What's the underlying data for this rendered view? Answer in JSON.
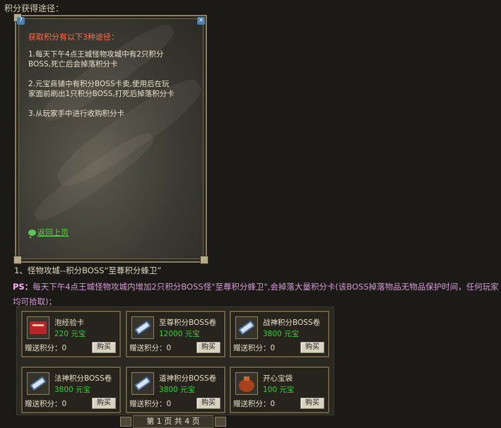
{
  "page": {
    "heading": "积分获得途径："
  },
  "dialog": {
    "help_glyph": "?",
    "close_glyph": "×",
    "title": "获取积分有以下3种途径：",
    "lines": [
      "1.每天下午4点王城怪物攻城中有2只积分",
      "BOSS,死亡后会掉落积分卡",
      "2.元宝商铺中有积分BOSS卡卖,使用后在玩",
      "家面前刷出1只积分BOSS,打死后掉落积分卡",
      "3.从玩家手中进行收购积分卡"
    ],
    "back_link": "返回上页"
  },
  "section": {
    "line1": "1、怪物攻城--积分BOSS“至尊积分蜂卫”",
    "ps_label": "PS：",
    "ps_text": "每天下午4点王城怪物攻城内增加2只积分BOSS怪\"至尊积分蜂卫\",会掉落大量积分卡(该BOSS掉落物品无物品保护时间，任何玩家均可拾取)；"
  },
  "shop": {
    "items": [
      {
        "name": "泡经验卡",
        "price": "220 元宝",
        "gift": "赠送积分：0",
        "buy": "购买",
        "icon": "card-icon",
        "color": "#b8242a"
      },
      {
        "name": "至尊积分BOSS卷",
        "price": "12000 元宝",
        "gift": "赠送积分：0",
        "buy": "购买",
        "icon": "scroll-icon",
        "color": "#4a6ea8"
      },
      {
        "name": "战神积分BOSS卷",
        "price": "3800 元宝",
        "gift": "赠送积分：0",
        "buy": "购买",
        "icon": "scroll-icon",
        "color": "#4a6ea8"
      },
      {
        "name": "法神积分BOSS卷",
        "price": "3800 元宝",
        "gift": "赠送积分：0",
        "buy": "购买",
        "icon": "scroll-icon",
        "color": "#4a6ea8"
      },
      {
        "name": "道神积分BOSS卷",
        "price": "3800 元宝",
        "gift": "赠送积分：0",
        "buy": "购买",
        "icon": "scroll-icon",
        "color": "#4a6ea8"
      },
      {
        "name": "开心宝袋",
        "price": "100 元宝",
        "gift": "赠送积分：0",
        "buy": "购买",
        "icon": "bag-icon",
        "color": "#a8421c"
      }
    ],
    "pager": "第 1 页 共 4 页"
  }
}
